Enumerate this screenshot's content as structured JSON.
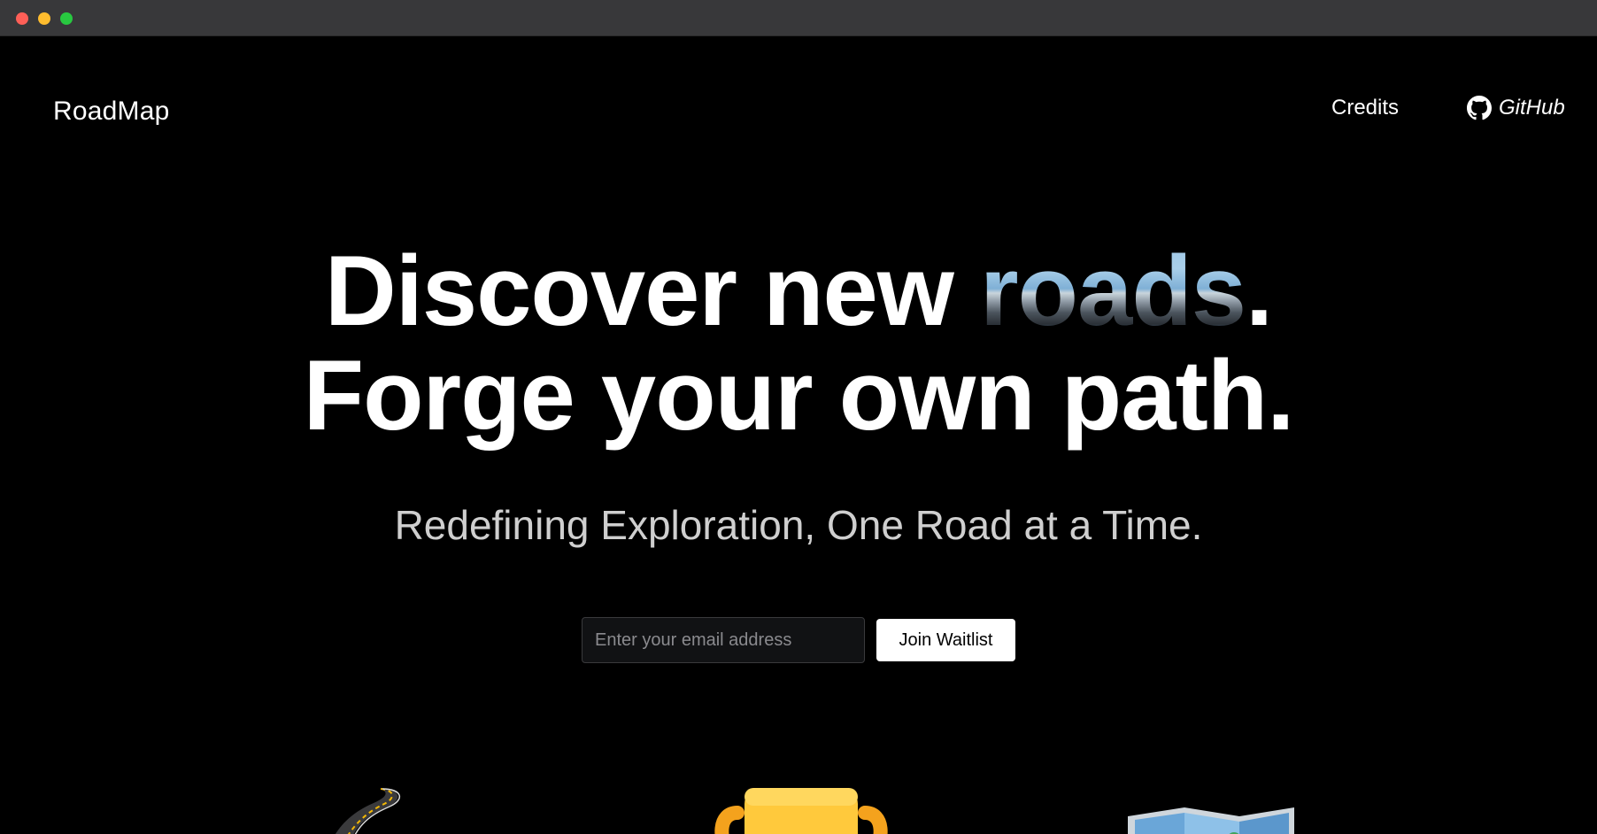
{
  "window": {
    "controls": [
      {
        "name": "close",
        "color": "#fe5f57"
      },
      {
        "name": "minimize",
        "color": "#febc2e"
      },
      {
        "name": "maximize",
        "color": "#28c840"
      }
    ]
  },
  "header": {
    "logo": "RoadMap",
    "nav": {
      "credits": "Credits",
      "github": "GitHub",
      "github_icon": "github-icon"
    }
  },
  "hero": {
    "line1_before": "Discover new ",
    "line1_highlight": "roads",
    "line1_after": ".",
    "line2": "Forge your own path."
  },
  "subtitle": "Redefining Exploration, One Road at a Time.",
  "waitlist": {
    "placeholder": "Enter your email address",
    "value": "",
    "button_label": "Join Waitlist"
  },
  "features": {
    "icons": [
      "road-icon",
      "trophy-icon",
      "map-icon"
    ]
  },
  "colors": {
    "background": "#000000",
    "titlebar": "#38383a",
    "text": "#ffffff",
    "subtitle": "#cfcfcf",
    "button_bg": "#ffffff",
    "input_bg": "#111214"
  }
}
